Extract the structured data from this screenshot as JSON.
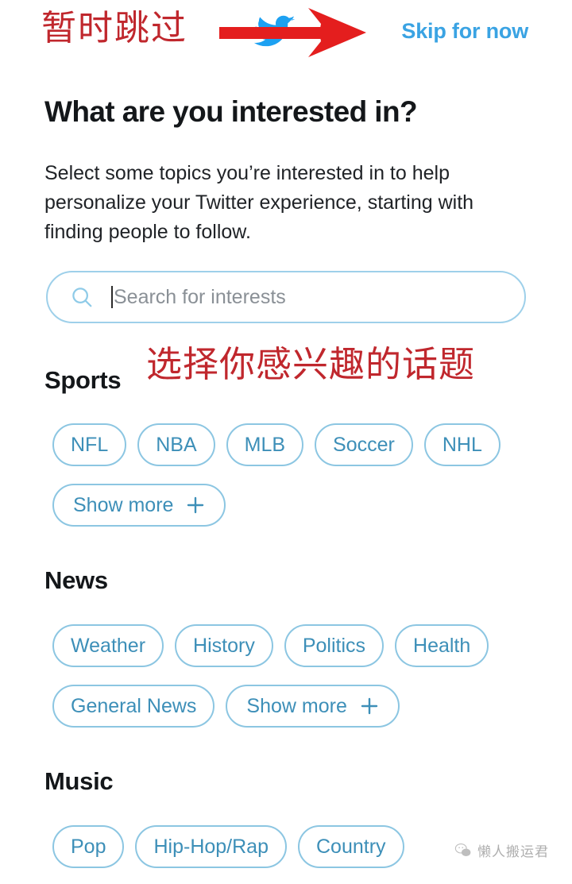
{
  "annotations": {
    "skip_cn": "暂时跳过",
    "topics_cn": "选择你感兴趣的话题"
  },
  "topbar": {
    "skip_label": "Skip for now",
    "brand_icon": "twitter-bird-icon",
    "pointer_icon": "red-arrow-icon",
    "accent_color": "#3aa3e3",
    "annotation_color": "#c0272d"
  },
  "main": {
    "title": "What are you interested in?",
    "description": "Select some topics you’re interested in to help personalize your Twitter experience, starting with finding people to follow."
  },
  "search": {
    "placeholder": "Search for interests",
    "value": "",
    "icon": "search-icon",
    "border_color": "#9ed0ea"
  },
  "chip_style": {
    "border_color": "#8cc6e2",
    "text_color": "#3d8fb8"
  },
  "sections": [
    {
      "id": "sports",
      "title": "Sports",
      "rows": [
        [
          {
            "label": "NFL",
            "icon": null
          },
          {
            "label": "NBA",
            "icon": null
          },
          {
            "label": "MLB",
            "icon": null
          },
          {
            "label": "Soccer",
            "icon": null
          },
          {
            "label": "NHL",
            "icon": null
          }
        ],
        [
          {
            "label": "Show more",
            "icon": "plus-icon"
          }
        ]
      ]
    },
    {
      "id": "news",
      "title": "News",
      "rows": [
        [
          {
            "label": "Weather",
            "icon": null
          },
          {
            "label": "History",
            "icon": null
          },
          {
            "label": "Politics",
            "icon": null
          },
          {
            "label": "Health",
            "icon": null
          }
        ],
        [
          {
            "label": "General News",
            "icon": null
          },
          {
            "label": "Show more",
            "icon": "plus-icon"
          }
        ]
      ]
    },
    {
      "id": "music",
      "title": "Music",
      "rows": [
        [
          {
            "label": "Pop",
            "icon": null
          },
          {
            "label": "Hip-Hop/Rap",
            "icon": null
          },
          {
            "label": "Country",
            "icon": null
          }
        ]
      ]
    }
  ],
  "watermark": {
    "text": "懒人搬运君",
    "icon": "wechat-icon"
  }
}
